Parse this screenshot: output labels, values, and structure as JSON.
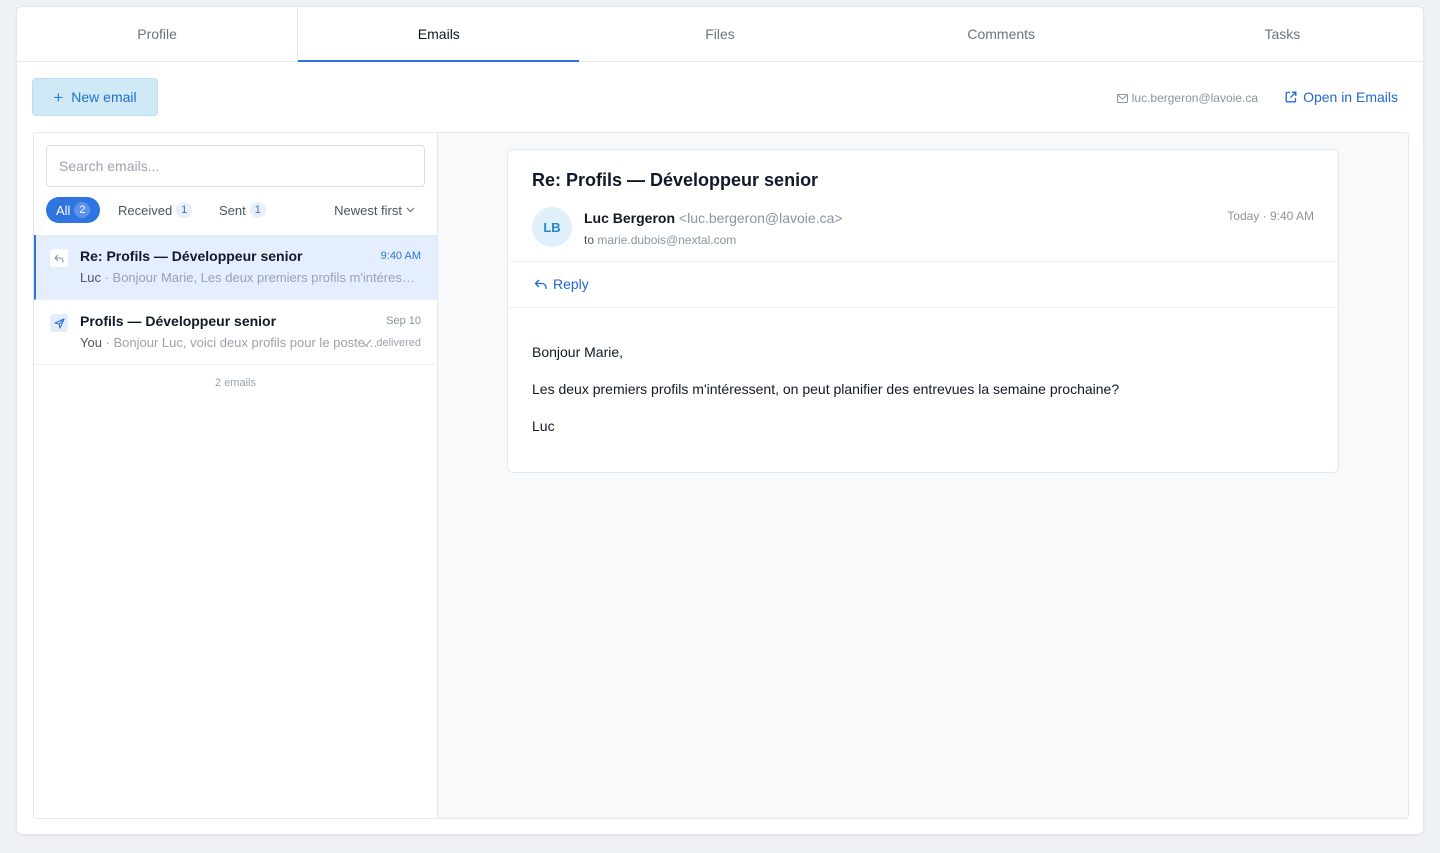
{
  "tabs": [
    {
      "label": "Profile"
    },
    {
      "label": "Emails"
    },
    {
      "label": "Files"
    },
    {
      "label": "Comments"
    },
    {
      "label": "Tasks"
    }
  ],
  "active_tab": "Emails",
  "toolbar": {
    "new_email_label": "New email",
    "contact_email": "luc.bergeron@lavoie.ca",
    "open_in_emails_label": "Open in Emails"
  },
  "list": {
    "search_placeholder": "Search emails...",
    "filters": [
      {
        "label": "All",
        "count": "2"
      },
      {
        "label": "Received",
        "count": "1"
      },
      {
        "label": "Sent",
        "count": "1"
      }
    ],
    "sort_label": "Newest first",
    "rows": [
      {
        "subject": "Re: Profils — Développeur senior",
        "time": "9:40 AM",
        "who": "Luc",
        "preview": " · Bonjour Marie, Les deux premiers profils m'intéressent, on peut planifier des entrevues la semaine prochaine?"
      },
      {
        "subject": "Profils — Développeur senior",
        "time": "Sep 10",
        "who": "You",
        "preview": " · Bonjour Luc, voici deux profils pour le poste de développeur senior.",
        "status": "delivered"
      }
    ],
    "footer": "2 emails"
  },
  "reader": {
    "subject": "Re: Profils — Développeur senior",
    "avatar_initials": "LB",
    "from_name": "Luc Bergeron",
    "from_address": "<luc.bergeron@lavoie.ca>",
    "to_label": "to",
    "to_address": "marie.dubois@nextal.com",
    "date": "Today · 9:40 AM",
    "reply_label": "Reply",
    "body": [
      "Bonjour Marie,",
      "Les deux premiers profils m'intéressent, on peut planifier des entrevues la semaine prochaine?",
      "Luc"
    ]
  },
  "colors": {
    "accent": "#2f74e0",
    "new_email_bg": "#cfe9f7",
    "selected_row_bg": "#e5eefc",
    "page_bg": "#eef1f6"
  }
}
